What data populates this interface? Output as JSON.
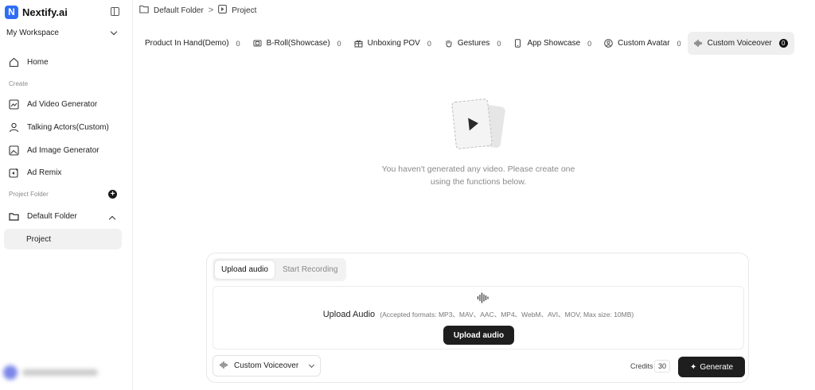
{
  "brand": {
    "logo_letter": "N",
    "name": "Nextify.ai"
  },
  "workspace": {
    "label": "My Workspace"
  },
  "sidebar": {
    "home": "Home",
    "create_label": "Create",
    "items": [
      {
        "label": "Ad Video Generator",
        "icon": "video-frame-icon"
      },
      {
        "label": "Talking Actors(Custom)",
        "icon": "user-icon"
      },
      {
        "label": "Ad Image Generator",
        "icon": "image-icon"
      },
      {
        "label": "Ad Remix",
        "icon": "remix-icon"
      }
    ],
    "project_folder_label": "Project Folder",
    "add_folder": "+",
    "folder": "Default Folder",
    "project": "Project"
  },
  "breadcrumb": {
    "folder": "Default Folder",
    "separator": ">",
    "page": "Project"
  },
  "tabs": [
    {
      "label": "Product In Hand(Demo)",
      "count": "0"
    },
    {
      "label": "B-Roll(Showcase)",
      "count": "0"
    },
    {
      "label": "Unboxing POV",
      "count": "0"
    },
    {
      "label": "Gestures",
      "count": "0"
    },
    {
      "label": "App Showcase",
      "count": "0"
    },
    {
      "label": "Custom Avatar",
      "count": "0"
    },
    {
      "label": "Custom Voiceover",
      "count": "0"
    }
  ],
  "empty_state": {
    "message": "You haven't generated any video. Please create one using the functions below."
  },
  "panel": {
    "mode_upload": "Upload audio",
    "mode_record": "Start Recording",
    "upload_title": "Upload Audio",
    "upload_formats": "(Accepted formats: MP3、MAV、AAC、MP4、WebM、AVI、MOV, Max size: 10MB)",
    "upload_button": "Upload audio",
    "voice_select": "Custom Voiceover",
    "credits_label": "Credits",
    "credits_value": "30",
    "generate": "Generate"
  },
  "colors": {
    "accent": "#2f6df6",
    "primary_button": "#1e1e1e"
  }
}
